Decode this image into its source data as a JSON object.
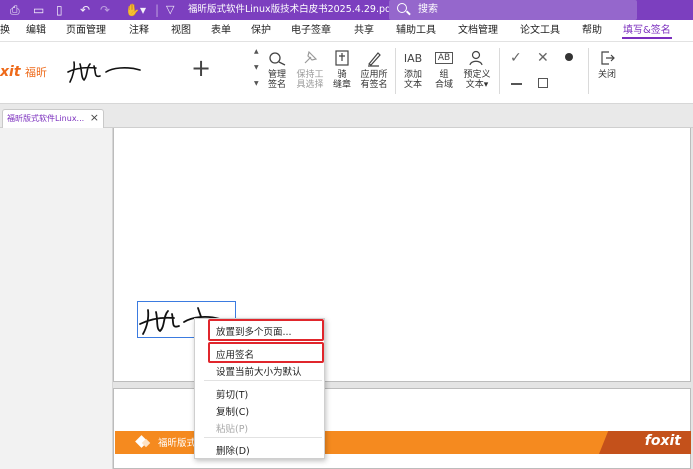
{
  "titlebar": {
    "doc_title": "福昕版式软件Linux版技术白皮书2025.4.29.pdf *",
    "search_placeholder": "搜索"
  },
  "menu": [
    "编辑",
    "页面管理",
    "注释",
    "视图",
    "表单",
    "保护",
    "电子签章",
    "共享",
    "辅助工具",
    "文档管理",
    "论文工具",
    "帮助",
    "填写&签名"
  ],
  "menu_active": "填写&签名",
  "menu_partial": "换",
  "ribbon": {
    "brand": "xit",
    "brand_cn": "福昕",
    "buttons": [
      {
        "id": "manage-sign",
        "label": "管理\n签名",
        "enabled": true
      },
      {
        "id": "keep-tool",
        "label": "保持工\n具选择",
        "enabled": false
      },
      {
        "id": "seam-stamp",
        "label": "骑\n缝章",
        "enabled": true
      },
      {
        "id": "apply-all",
        "label": "应用所\n有签名",
        "enabled": true
      },
      {
        "id": "add-text",
        "label": "添加\n文本",
        "enabled": true
      },
      {
        "id": "combo-field",
        "label": "组\n合域",
        "enabled": true
      },
      {
        "id": "predefined-text",
        "label": "预定义\n文本▾",
        "enabled": true
      },
      {
        "id": "close",
        "label": "关闭",
        "enabled": true
      }
    ]
  },
  "tab": {
    "label": "福昕版式软件Linux...",
    "close": "×"
  },
  "footer_bar": {
    "text": "福昕版式",
    "brand": "foxit"
  },
  "context_menu": [
    {
      "label": "放置到多个页面...",
      "enabled": true,
      "highlight": true
    },
    {
      "label": "应用签名",
      "enabled": true,
      "highlight": true
    },
    {
      "label": "设置当前大小为默认",
      "enabled": true
    },
    {
      "label": "剪切(T)",
      "enabled": true
    },
    {
      "label": "复制(C)",
      "enabled": true
    },
    {
      "label": "粘贴(P)",
      "enabled": false
    },
    {
      "label": "删除(D)",
      "enabled": true
    }
  ],
  "colors": {
    "accent": "#7c3fbf",
    "brand_orange": "#f58a1f",
    "highlight": "#e0262c",
    "selection": "#3b7be0"
  }
}
